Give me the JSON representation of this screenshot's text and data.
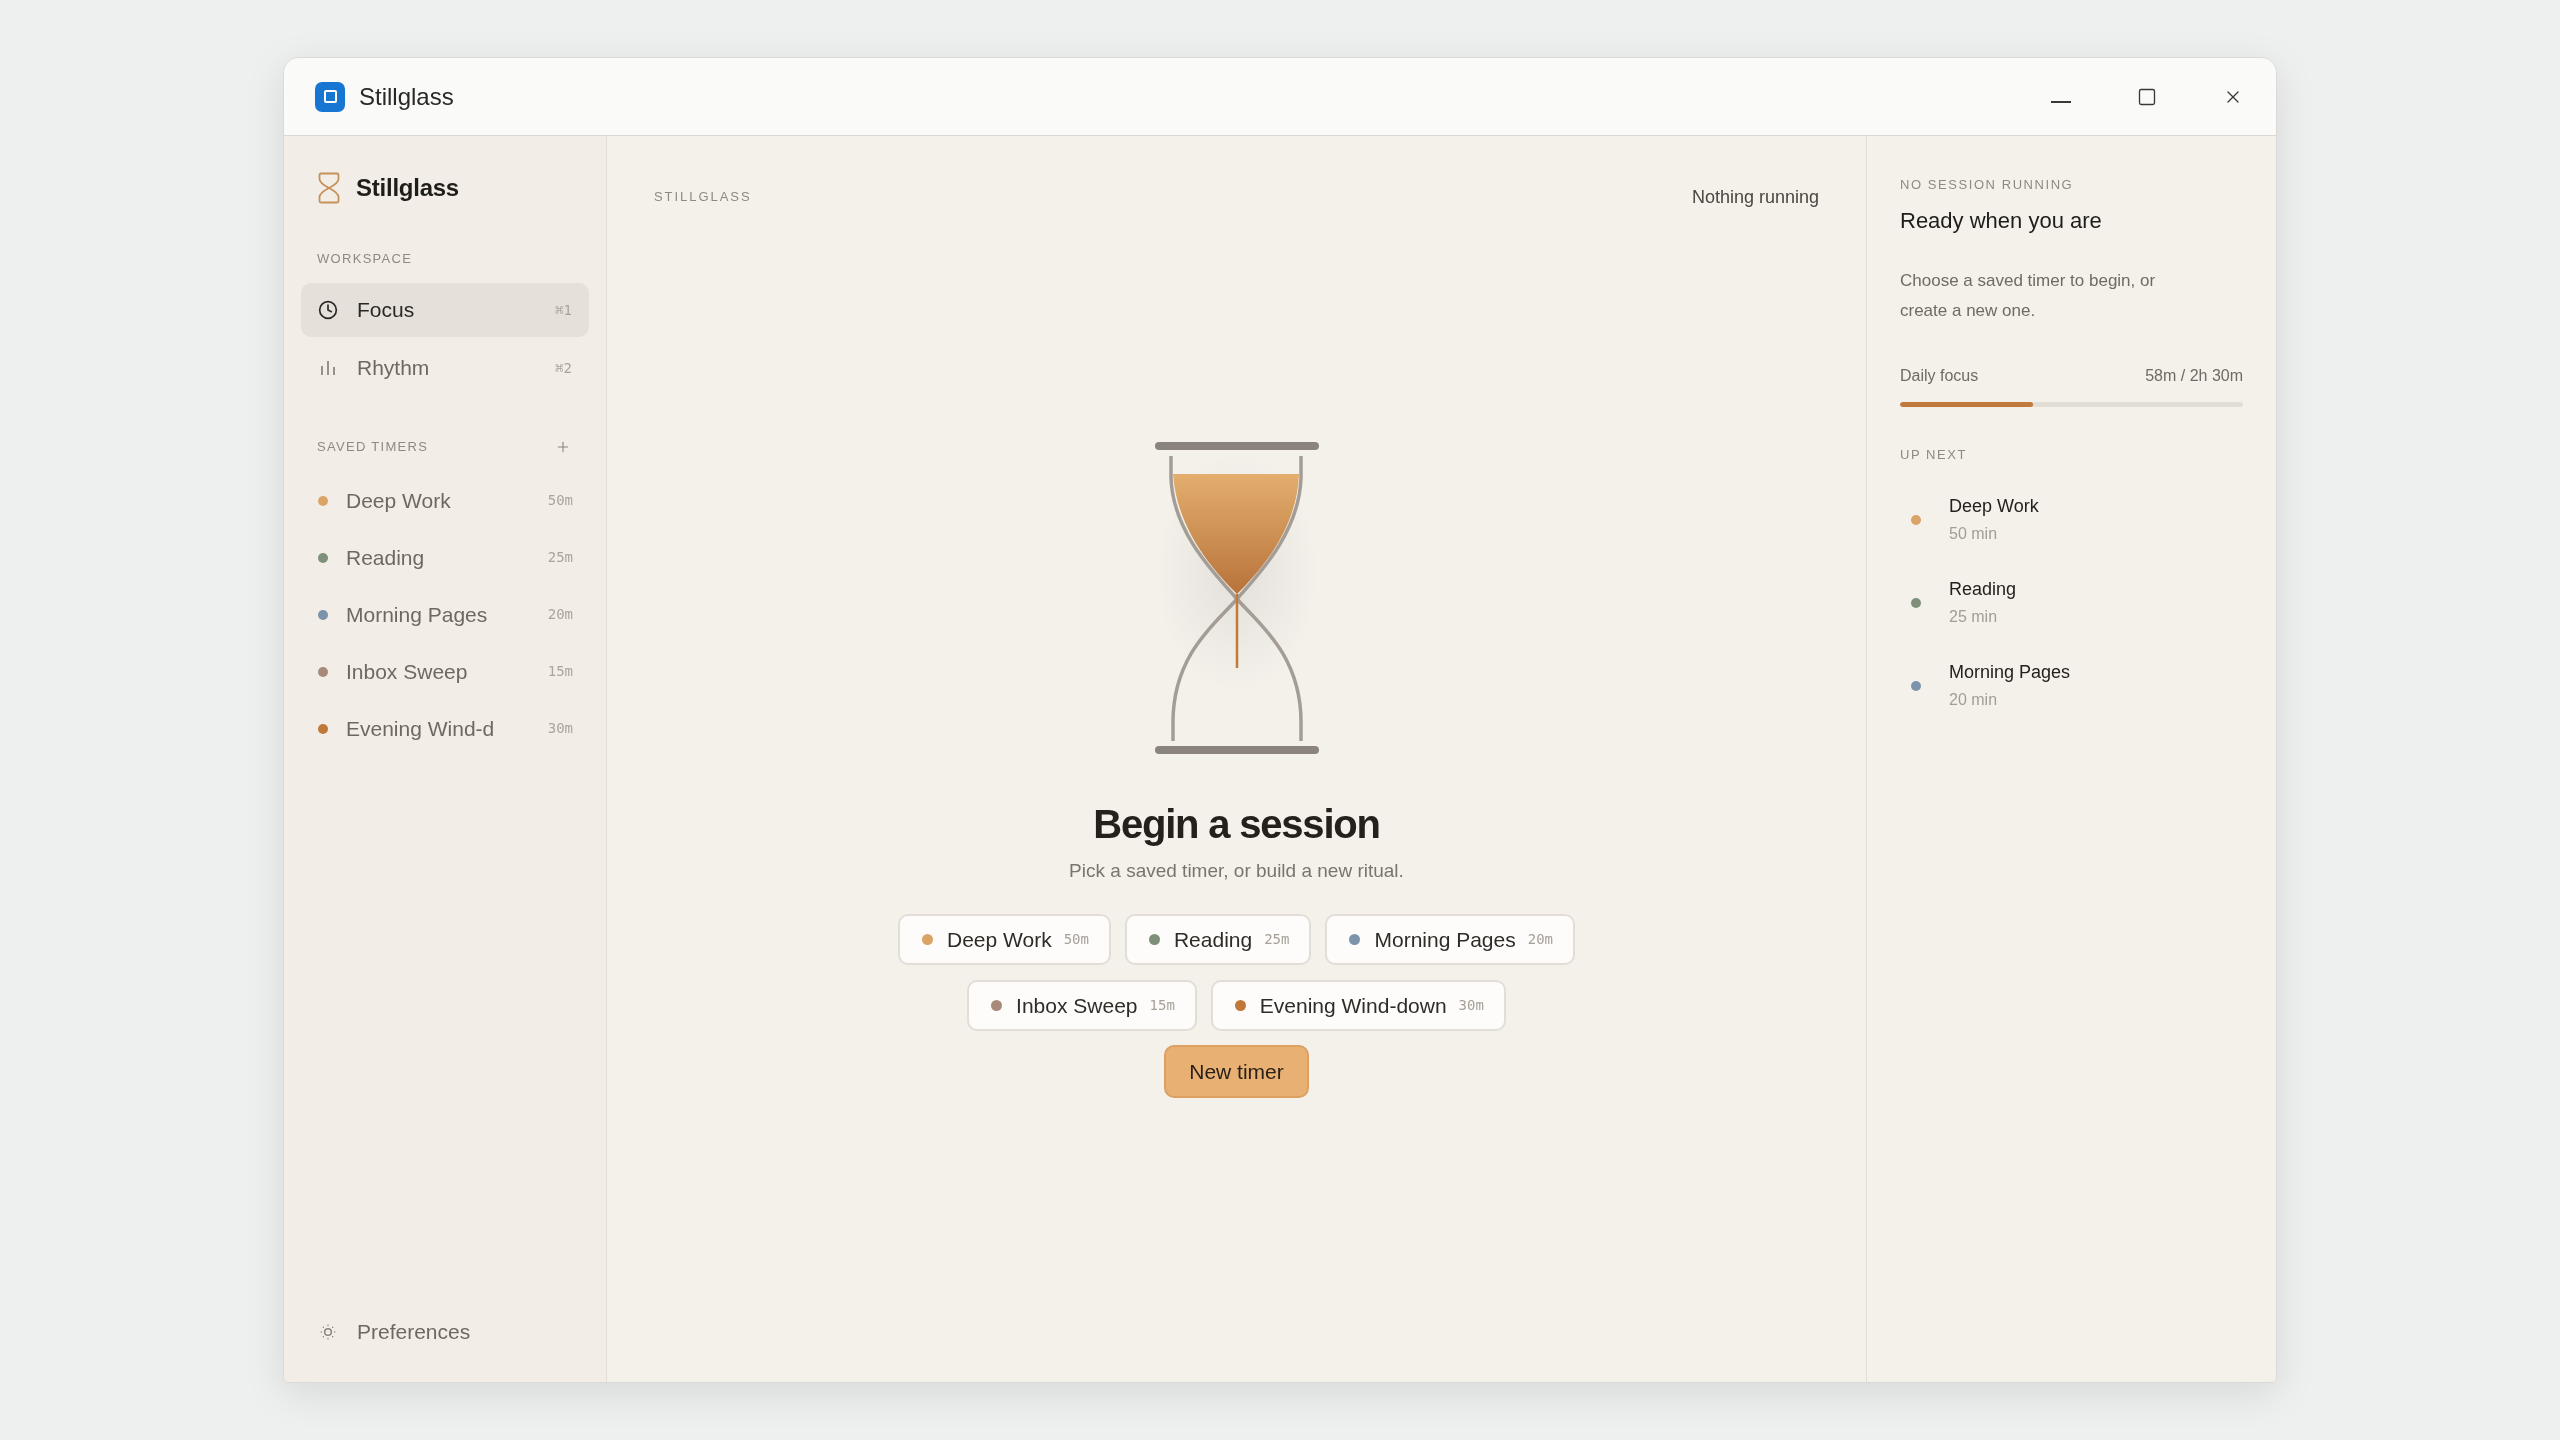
{
  "window": {
    "title": "Stillglass"
  },
  "sidebar": {
    "brand": "Stillglass",
    "workspace": {
      "heading": "WORKSPACE",
      "items": [
        {
          "label": "Focus",
          "shortcut": "⌘1",
          "selected": true
        },
        {
          "label": "Rhythm",
          "shortcut": "⌘2",
          "selected": false
        }
      ]
    },
    "saved_timers": {
      "heading": "SAVED TIMERS",
      "items": [
        {
          "label": "Deep Work",
          "duration": "50m",
          "color": "#d9a466"
        },
        {
          "label": "Reading",
          "duration": "25m",
          "color": "#7e9079"
        },
        {
          "label": "Morning Pages",
          "duration": "20m",
          "color": "#7b93ab"
        },
        {
          "label": "Inbox Sweep",
          "duration": "15m",
          "color": "#a88a7b"
        },
        {
          "label": "Evening Wind-d",
          "duration": "30m",
          "color": "#c0773a"
        }
      ]
    },
    "footer": {
      "label": "Preferences"
    }
  },
  "main": {
    "eyebrow": "STILLGLASS",
    "status": "Nothing running",
    "title": "Begin a session",
    "subtitle": "Pick a saved timer, or build a new ritual.",
    "timers": [
      {
        "label": "Deep Work",
        "duration": "50m",
        "color": "#d9a466"
      },
      {
        "label": "Reading",
        "duration": "25m",
        "color": "#7e9079"
      },
      {
        "label": "Morning Pages",
        "duration": "20m",
        "color": "#7b93ab"
      },
      {
        "label": "Inbox Sweep",
        "duration": "15m",
        "color": "#a88a7b"
      },
      {
        "label": "Evening Wind-down",
        "duration": "30m",
        "color": "#c0773a"
      }
    ],
    "new_timer_button": "New timer"
  },
  "session_panel": {
    "eyebrow": "NO SESSION RUNNING",
    "title": "Ready when you are",
    "description": "Choose a saved timer to begin, or create a new one.",
    "daily_focus": {
      "label": "Daily focus",
      "reading": "58m / 2h 30m",
      "level": 0.387
    },
    "up_next": {
      "heading": "UP NEXT",
      "items": [
        {
          "label": "Deep Work",
          "duration": "50 min",
          "color": "#d9a466"
        },
        {
          "label": "Reading",
          "duration": "25 min",
          "color": "#7e9079"
        },
        {
          "label": "Morning Pages",
          "duration": "20 min",
          "color": "#7b93ab"
        }
      ]
    }
  }
}
